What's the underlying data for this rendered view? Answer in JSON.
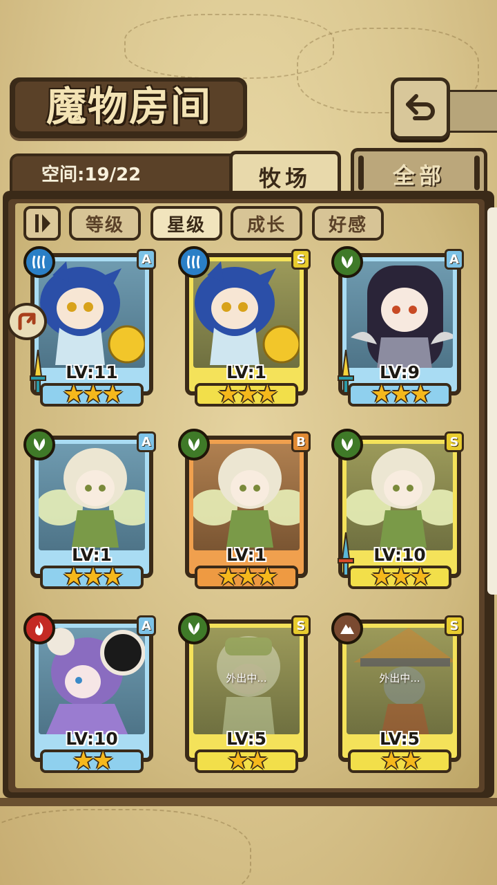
{
  "header": {
    "title": "魔物房间"
  },
  "space": {
    "text": "空间:19/22"
  },
  "tabs": [
    {
      "label": "牧场"
    },
    {
      "label": "全部"
    }
  ],
  "sort": {
    "buttons": [
      {
        "label": "等级"
      },
      {
        "label": "星级"
      },
      {
        "label": "成长"
      },
      {
        "label": "好感"
      }
    ],
    "active": "星级"
  },
  "monsters": [
    {
      "level": "LV:11",
      "rank": "A",
      "element": "water",
      "stars": "★★★",
      "frame": "blue",
      "equipped": true,
      "status": ""
    },
    {
      "level": "LV:1",
      "rank": "S",
      "element": "water",
      "stars": "★★★",
      "frame": "gold",
      "equipped": false,
      "status": ""
    },
    {
      "level": "LV:9",
      "rank": "A",
      "element": "grass",
      "stars": "★★★",
      "frame": "blue",
      "equipped": true,
      "status": ""
    },
    {
      "level": "LV:1",
      "rank": "A",
      "element": "grass",
      "stars": "★★★",
      "frame": "blue",
      "equipped": false,
      "status": ""
    },
    {
      "level": "LV:1",
      "rank": "B",
      "element": "grass",
      "stars": "★★★",
      "frame": "orange",
      "equipped": false,
      "status": ""
    },
    {
      "level": "LV:10",
      "rank": "S",
      "element": "grass",
      "stars": "★★★",
      "frame": "gold",
      "equipped": true,
      "status": ""
    },
    {
      "level": "LV:10",
      "rank": "A",
      "element": "fire",
      "stars": "★★",
      "frame": "blue",
      "equipped": false,
      "status": ""
    },
    {
      "level": "LV:5",
      "rank": "S",
      "element": "grass",
      "stars": "★★",
      "frame": "gold",
      "equipped": false,
      "status": "外出中..."
    },
    {
      "level": "LV:5",
      "rank": "S",
      "element": "earth",
      "stars": "★★",
      "frame": "gold",
      "equipped": false,
      "status": "外出中..."
    }
  ],
  "colors": {
    "border": "#3a2a18",
    "blue_frame": "#a9dcf3",
    "gold_frame": "#f4e25a",
    "orange_frame": "#f0a04e",
    "star": "#f5b81c"
  }
}
